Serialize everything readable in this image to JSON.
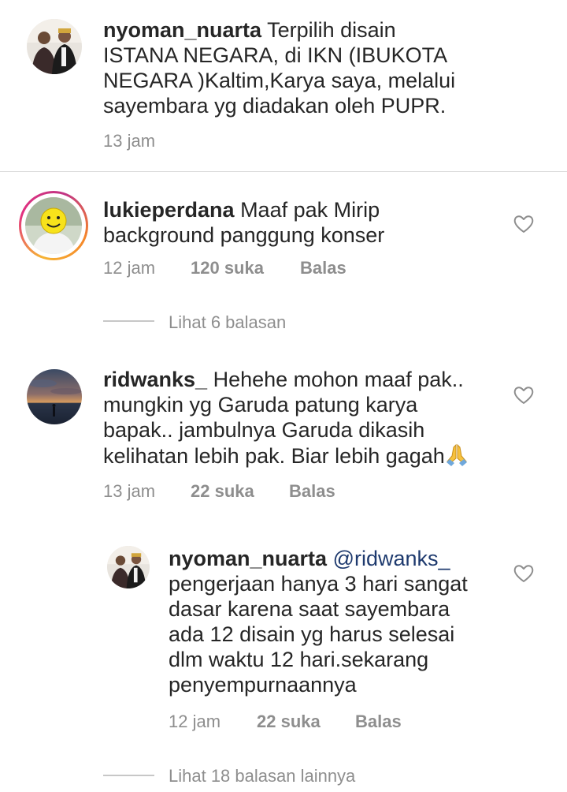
{
  "comments": [
    {
      "username": "nyoman_nuarta",
      "text": " Terpilih disain ISTANA NEGARA, di IKN (IBUKOTA NEGARA )Kaltim,Karya saya, melalui sayembara yg diadakan oleh PUPR.",
      "lines": [
        "ISTANA NEGARA, di IKN (IBUKOTA",
        "NEGARA )Kaltim,Karya saya, melalui",
        "sayembara yg diadakan oleh PUPR."
      ],
      "first_line": " Terpilih disain",
      "time": "13 jam"
    },
    {
      "username": "lukieperdana",
      "first_line": " Maaf pak Mirip",
      "lines": [
        "background panggung konser"
      ],
      "time": "12 jam",
      "likes": "120 suka",
      "reply_label": "Balas",
      "view_replies": "Lihat 6 balasan"
    },
    {
      "username": "ridwanks_",
      "first_line": " Hehehe mohon maaf pak..",
      "lines": [
        "mungkin yg Garuda patung karya",
        "bapak.. jambulnya Garuda dikasih",
        "kelihatan lebih pak. Biar lebih gagah"
      ],
      "emoji": "folded-hands",
      "time": "13 jam",
      "likes": "22 suka",
      "reply_label": "Balas"
    },
    {
      "username": "nyoman_nuarta",
      "mention": " @ridwanks_",
      "lines": [
        "pengerjaan hanya 3 hari sangat",
        "dasar karena saat sayembara",
        "ada 12 disain yg harus selesai",
        "dlm waktu 12 hari.sekarang",
        "penyempurnaannya"
      ],
      "time": "12 jam",
      "likes": "22 suka",
      "reply_label": "Balas",
      "view_replies": "Lihat 18 balasan lainnya"
    }
  ],
  "icons": {
    "like": "heart-outline-icon"
  },
  "colors": {
    "meta": "#8e8e8e",
    "mention": "#1e3a6e",
    "divider": "#dbdbdb"
  }
}
